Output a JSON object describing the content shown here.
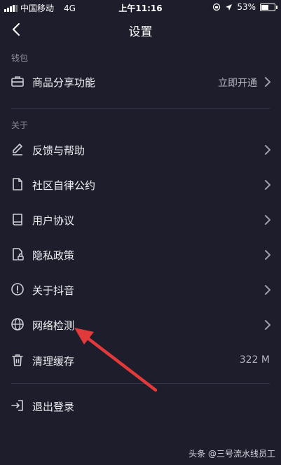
{
  "status_bar": {
    "carrier": "中国移动",
    "network": "4G",
    "time": "上午11:16",
    "battery": "53%"
  },
  "nav": {
    "title": "设置"
  },
  "sections": [
    {
      "label": "钱包"
    },
    {
      "label": "关于"
    }
  ],
  "items": [
    {
      "label": "商品分享功能",
      "value": "立即开通",
      "icon": "briefcase-icon"
    },
    {
      "label": "反馈与帮助",
      "icon": "pencil-icon"
    },
    {
      "label": "社区自律公约",
      "icon": "document-icon"
    },
    {
      "label": "用户协议",
      "icon": "book-icon"
    },
    {
      "label": "隐私政策",
      "icon": "lock-document-icon"
    },
    {
      "label": "关于抖音",
      "icon": "info-icon"
    },
    {
      "label": "网络检测",
      "icon": "globe-icon"
    },
    {
      "label": "清理缓存",
      "value": "322 M",
      "icon": "trash-icon"
    },
    {
      "label": "退出登录",
      "icon": "logout-icon"
    }
  ],
  "watermark": "头条 @三号流水线员工",
  "colors": {
    "background": "#1d1d2b",
    "arrow": "#e23a3a"
  }
}
